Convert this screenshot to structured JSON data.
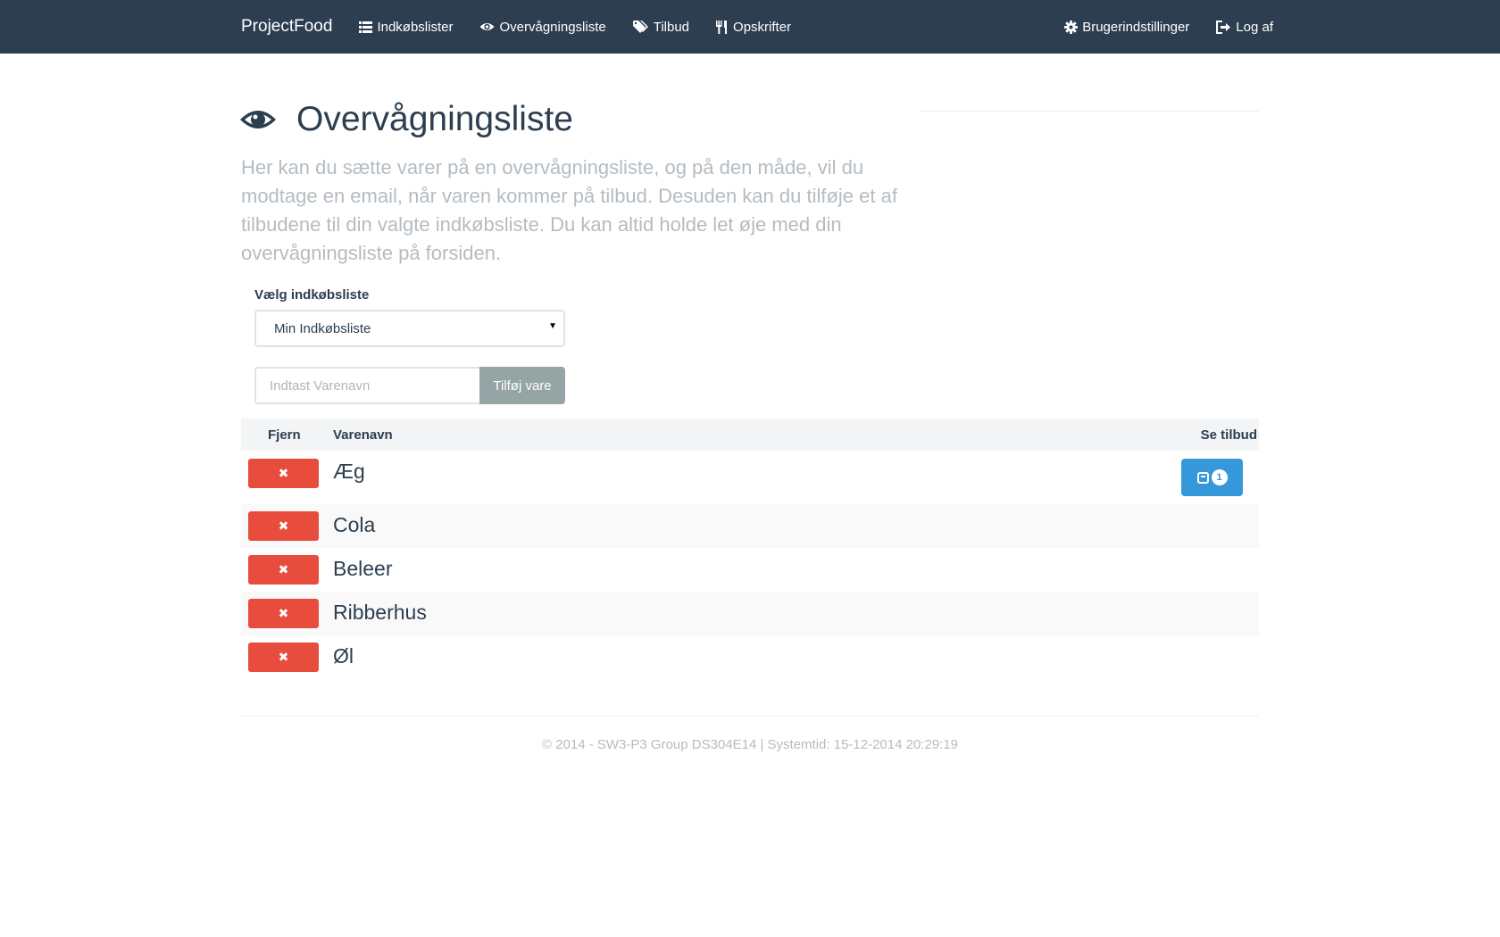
{
  "navbar": {
    "brand": "ProjectFood",
    "left_items": [
      {
        "label": "Indkøbslister",
        "icon": "list-icon"
      },
      {
        "label": "Overvågningsliste",
        "icon": "eye-icon"
      },
      {
        "label": "Tilbud",
        "icon": "tags-icon"
      },
      {
        "label": "Opskrifter",
        "icon": "cutlery-icon"
      }
    ],
    "right_items": [
      {
        "label": "Brugerindstillinger",
        "icon": "gear-icon"
      },
      {
        "label": "Log af",
        "icon": "logout-icon"
      }
    ]
  },
  "header": {
    "title": "Overvågningsliste",
    "icon": "eye-icon",
    "lead": "Her kan du sætte varer på en overvågningsliste, og på den måde, vil du modtage en email, når varen kommer på tilbud. Desuden kan du tilføje et af tilbudene til din valgte indkøbsliste. Du kan altid holde let øje med din overvågningsliste på forsiden."
  },
  "form": {
    "select_label": "Vælg indkøbsliste",
    "select_value": "Min Indkøbsliste",
    "input_placeholder": "Indtast Varenavn",
    "add_button": "Tilføj vare"
  },
  "table": {
    "headers": {
      "remove": "Fjern",
      "name": "Varenavn",
      "offers": "Se tilbud"
    },
    "rows": [
      {
        "name": "Æg",
        "offer_count": "1"
      },
      {
        "name": "Cola"
      },
      {
        "name": "Beleer"
      },
      {
        "name": "Ribberhus"
      },
      {
        "name": "Øl"
      }
    ]
  },
  "footer": {
    "text": "© 2014 - SW3-P3 Group DS304E14 | Systemtid: 15-12-2014 20:29:19"
  },
  "colors": {
    "navbar": "#2c3e50",
    "danger": "#e74c3c",
    "primary": "#3498db",
    "muted": "#b4bcc2",
    "default_button": "#95a5a6"
  }
}
